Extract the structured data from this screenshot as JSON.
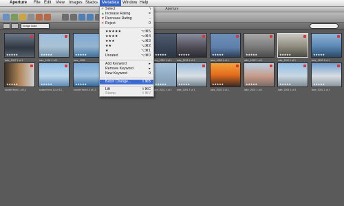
{
  "menubar": {
    "items": [
      "Aperture",
      "File",
      "Edit",
      "View",
      "Images",
      "Stacks",
      "Metadata",
      "Window",
      "Help"
    ]
  },
  "window": {
    "title": "Aperture"
  },
  "filter": {
    "sort": "Image Date"
  },
  "menu": {
    "select": {
      "label": "Select",
      "shortcut": "\\"
    },
    "increase": {
      "label": "Increase Rating",
      "shortcut": "="
    },
    "decrease": {
      "label": "Decrease Rating",
      "shortcut": "-"
    },
    "reject": {
      "label": "Reject",
      "shortcut": "0"
    },
    "stars": [
      {
        "label": "★★★★★",
        "shortcut": "⌥⌘5"
      },
      {
        "label": "★★★★",
        "shortcut": "⌥⌘4"
      },
      {
        "label": "★★★",
        "shortcut": "⌥⌘3"
      },
      {
        "label": "★★",
        "shortcut": "⌥⌘2"
      },
      {
        "label": "★",
        "shortcut": "⌥⌘1"
      }
    ],
    "unrated": {
      "label": "Unrated",
      "shortcut": "⌥⌘0"
    },
    "add_keyword": {
      "label": "Add Keyword",
      "shortcut": "▸"
    },
    "remove_keyword": {
      "label": "Remove Keyword",
      "shortcut": "▸"
    },
    "new_keyword": {
      "label": "New Keyword",
      "shortcut": "9"
    },
    "batch": {
      "label": "Batch Change...",
      "shortcut": "⇧⌘B"
    },
    "lift": {
      "label": "Lift",
      "shortcut": "⇧⌘C"
    },
    "stamp": {
      "label": "Stamp",
      "shortcut": "⇧⌘V"
    }
  },
  "thumbs_row1": [
    {
      "stars": "★★★★★",
      "caption": "lake_1047 1 of 1"
    },
    {
      "stars": "★★★★★",
      "caption": "lake_1031 1 of 1"
    },
    {
      "stars": "★★★★★",
      "caption": "lake_1055"
    },
    {
      "stars": "",
      "caption": ""
    },
    {
      "stars": "★★★★★",
      "caption": "lake_1051 1 of 1"
    },
    {
      "stars": "★★★★★",
      "caption": "lake_1123 1 of 1"
    },
    {
      "stars": "★★★★★",
      "caption": "lake_1089 1 of 1"
    },
    {
      "stars": "★★★★★",
      "caption": "lake_1092 1 of 1"
    },
    {
      "stars": "★★★★★",
      "caption": "lake_1110 1 of 1"
    },
    {
      "stars": "★★★★★",
      "caption": "lake_1132 1 of 1"
    },
    {
      "stars": "★★★★★",
      "caption": "lake_1144 1 of 1"
    }
  ],
  "thumbs_row2": [
    {
      "stars": "★★★★★",
      "caption": "sunset from 1 of 13"
    },
    {
      "stars": "★★★★★",
      "caption": "sunset from 13 of 13"
    },
    {
      "stars": "★★★★★",
      "caption": "sunset from 13 of 13"
    },
    {
      "stars": "",
      "caption": ""
    },
    {
      "stars": "★★★★★",
      "caption": "lake_2001 1 of 1"
    },
    {
      "stars": "★★★★★",
      "caption": "lake_2001 1 of 1"
    },
    {
      "stars": "★★★★★",
      "caption": "lake_2001 1 of 1"
    },
    {
      "stars": "★★★★★",
      "caption": "lake_2001 1 of 1"
    },
    {
      "stars": "★★★★★",
      "caption": "lake_2001 1 of 1"
    },
    {
      "stars": "★★★★★",
      "caption": "lake_2001 1 of 1"
    },
    {
      "stars": "★★★★★",
      "caption": "lake_2001 1 of 1"
    }
  ]
}
